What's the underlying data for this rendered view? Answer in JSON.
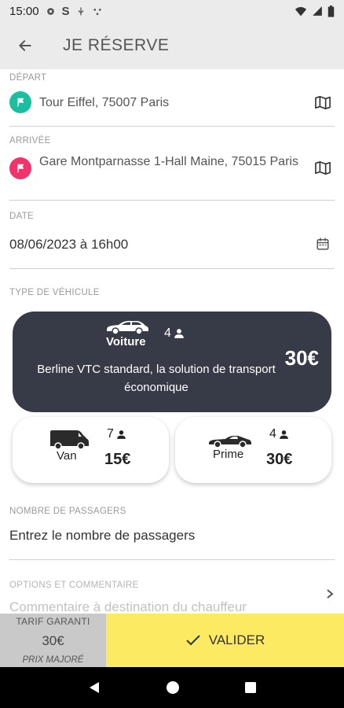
{
  "status_bar": {
    "time": "15:00"
  },
  "app_bar": {
    "title": "JE RÉSERVE"
  },
  "depart": {
    "label": "DÉPART",
    "value": "Tour Eiffel, 75007 Paris"
  },
  "arrivee": {
    "label": "ARRIVÉE",
    "value": "Gare Montparnasse 1-Hall Maine, 75015 Paris"
  },
  "date": {
    "label": "DATE",
    "value": "08/06/2023 à 16h00"
  },
  "vehicle_type": {
    "label": "TYPE DE VÉHICULE",
    "selected": {
      "name": "Voiture",
      "capacity": "4",
      "description": "Berline VTC standard, la solution de transport économique",
      "price": "30€"
    },
    "options": [
      {
        "name": "Van",
        "capacity": "7",
        "price": "15€"
      },
      {
        "name": "Prime",
        "capacity": "4",
        "price": "30€"
      }
    ]
  },
  "passengers": {
    "label": "NOMBRE DE PASSAGERS",
    "placeholder": "Entrez le nombre de passagers"
  },
  "options": {
    "label": "OPTIONS ET COMMENTAIRE",
    "placeholder": "Commentaire à destination du chauffeur"
  },
  "tarif": {
    "title": "TARIF GARANTI",
    "price": "30€",
    "note": "PRIX MAJORÉ"
  },
  "validate": {
    "label": "VALIDER"
  },
  "colors": {
    "accent_yellow": "#fdea63",
    "card_dark": "#373a47",
    "depart_pin": "#1bbf9f",
    "arrivee_pin": "#f0336b"
  }
}
